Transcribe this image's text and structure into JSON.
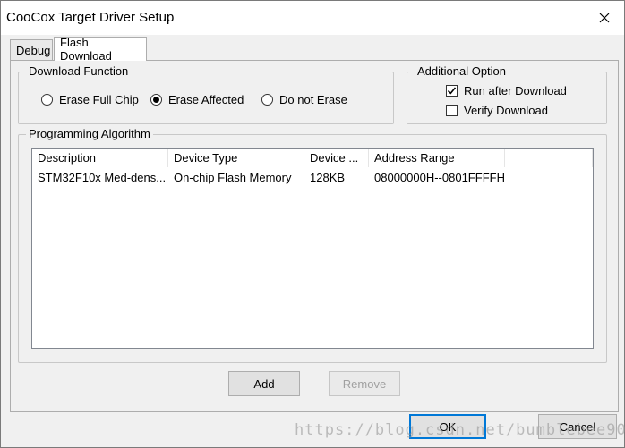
{
  "window": {
    "title": "CooCox Target Driver Setup"
  },
  "tabs": [
    {
      "label": "Debug",
      "active": false
    },
    {
      "label": "Flash Download",
      "active": true
    }
  ],
  "download_function": {
    "label": "Download Function",
    "options": [
      {
        "label": "Erase Full Chip",
        "selected": false
      },
      {
        "label": "Erase Affected",
        "selected": true
      },
      {
        "label": "Do not Erase",
        "selected": false
      }
    ]
  },
  "additional_option": {
    "label": "Additional Option",
    "options": [
      {
        "label": "Run after Download",
        "checked": true
      },
      {
        "label": "Verify Download",
        "checked": false
      }
    ]
  },
  "programming_algorithm": {
    "label": "Programming Algorithm",
    "columns": [
      "Description",
      "Device Type",
      "Device ...",
      "Address Range",
      ""
    ],
    "rows": [
      [
        "STM32F10x Med-dens...",
        "On-chip Flash Memory",
        "128KB",
        "08000000H--0801FFFFH"
      ]
    ]
  },
  "buttons": {
    "add": "Add",
    "remove": "Remove",
    "ok": "OK",
    "cancel": "Cancel"
  },
  "watermark": "https://blog.csdn.net/bumblebee9097"
}
